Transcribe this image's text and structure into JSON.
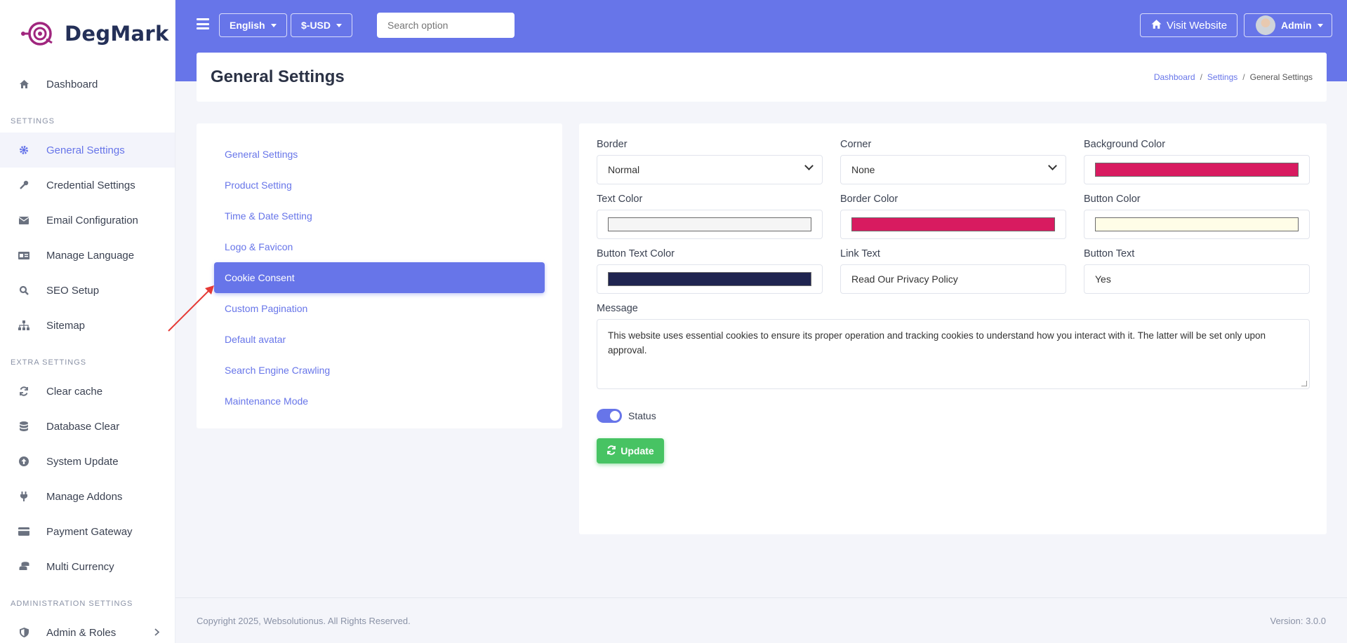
{
  "brand": {
    "name": "DegMark"
  },
  "sidebar": {
    "top_item": {
      "label": "Dashboard",
      "icon": "home-icon"
    },
    "sections": [
      {
        "title": "SETTINGS",
        "items": [
          {
            "label": "General Settings",
            "icon": "gear-icon",
            "active": true
          },
          {
            "label": "Credential Settings",
            "icon": "key-icon"
          },
          {
            "label": "Email Configuration",
            "icon": "envelope-icon"
          },
          {
            "label": "Manage Language",
            "icon": "language-icon"
          },
          {
            "label": "SEO Setup",
            "icon": "search-icon"
          },
          {
            "label": "Sitemap",
            "icon": "sitemap-icon"
          }
        ]
      },
      {
        "title": "EXTRA SETTINGS",
        "items": [
          {
            "label": "Clear cache",
            "icon": "refresh-icon"
          },
          {
            "label": "Database Clear",
            "icon": "database-icon"
          },
          {
            "label": "System Update",
            "icon": "upload-icon"
          },
          {
            "label": "Manage Addons",
            "icon": "plug-icon"
          },
          {
            "label": "Payment Gateway",
            "icon": "credit-card-icon"
          },
          {
            "label": "Multi Currency",
            "icon": "coins-icon"
          }
        ]
      },
      {
        "title": "ADMINISTRATION SETTINGS",
        "items": [
          {
            "label": "Admin & Roles",
            "icon": "shield-icon",
            "has_children": true
          }
        ]
      }
    ]
  },
  "topbar": {
    "language": "English",
    "currency": "$-USD",
    "search_placeholder": "Search option",
    "visit_website": "Visit Website",
    "user": "Admin"
  },
  "header": {
    "title": "General Settings",
    "breadcrumb": [
      "Dashboard",
      "Settings",
      "General Settings"
    ]
  },
  "settings_menu": [
    {
      "label": "General Settings"
    },
    {
      "label": "Product Setting"
    },
    {
      "label": "Time & Date Setting"
    },
    {
      "label": "Logo & Favicon"
    },
    {
      "label": "Cookie Consent",
      "active": true
    },
    {
      "label": "Custom Pagination"
    },
    {
      "label": "Default avatar"
    },
    {
      "label": "Search Engine Crawling"
    },
    {
      "label": "Maintenance Mode"
    }
  ],
  "form": {
    "border": {
      "label": "Border",
      "value": "Normal"
    },
    "corner": {
      "label": "Corner",
      "value": "None"
    },
    "background_color": {
      "label": "Background Color",
      "value": "#d81b60"
    },
    "text_color": {
      "label": "Text Color",
      "value": "#f5f5f5"
    },
    "border_color": {
      "label": "Border Color",
      "value": "#d81b60"
    },
    "button_color": {
      "label": "Button Color",
      "value": "#fffde7"
    },
    "button_text_color": {
      "label": "Button Text Color",
      "value": "#1f2450"
    },
    "link_text": {
      "label": "Link Text",
      "value": "Read Our Privacy Policy"
    },
    "button_text": {
      "label": "Button Text",
      "value": "Yes"
    },
    "message": {
      "label": "Message",
      "value": "This website uses essential cookies to ensure its proper operation and tracking cookies to understand how you interact with it. The latter will be set only upon approval."
    },
    "status": {
      "label": "Status",
      "enabled": true
    },
    "update_label": "Update"
  },
  "footer": {
    "copyright": "Copyright 2025, Websolutionus. All Rights Reserved.",
    "version": "Version: 3.0.0"
  },
  "colors": {
    "accent": "#6775e9",
    "success": "#47c363"
  }
}
